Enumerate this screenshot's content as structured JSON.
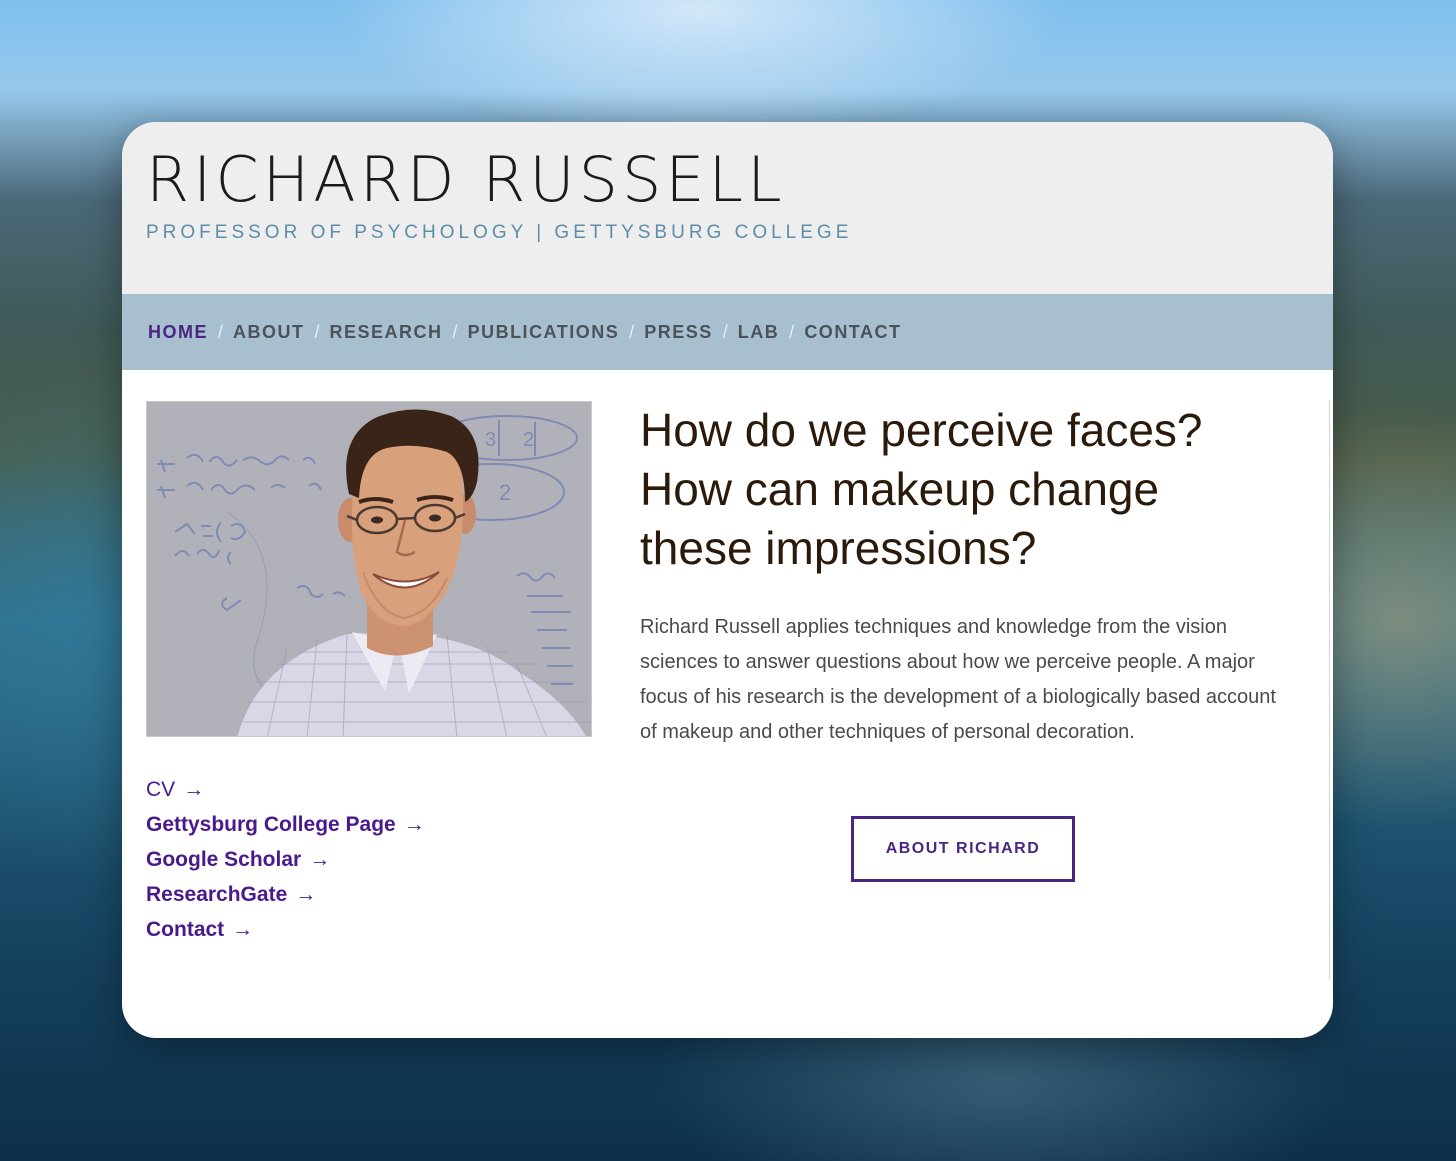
{
  "header": {
    "title": "RICHARD RUSSELL",
    "tagline": "PROFESSOR OF PSYCHOLOGY | GETTYSBURG COLLEGE"
  },
  "nav": {
    "separator": "/",
    "items": [
      {
        "label": "HOME",
        "active": true
      },
      {
        "label": "ABOUT"
      },
      {
        "label": "RESEARCH"
      },
      {
        "label": "PUBLICATIONS"
      },
      {
        "label": "PRESS"
      },
      {
        "label": "LAB"
      },
      {
        "label": "CONTACT"
      }
    ]
  },
  "links": {
    "arrow": "→",
    "items": [
      {
        "label": "CV"
      },
      {
        "label": "Gettysburg College Page"
      },
      {
        "label": "Google Scholar"
      },
      {
        "label": "ResearchGate"
      },
      {
        "label": "Contact"
      }
    ]
  },
  "main": {
    "headline": "How do we perceive faces? How can makeup change these impressions?",
    "bio": "Richard Russell applies techniques and knowledge from the vision sciences to answer questions about how we perceive people. A major focus of his research is the development of a biologically based account of makeup and other techniques of personal decoration.",
    "about_button": "ABOUT RICHARD"
  },
  "colors": {
    "accent": "#4a2680",
    "link": "#4a1a8c",
    "nav_background": "#a8bfd0",
    "header_background": "#eeeeee",
    "tagline": "#5c8ea9"
  }
}
